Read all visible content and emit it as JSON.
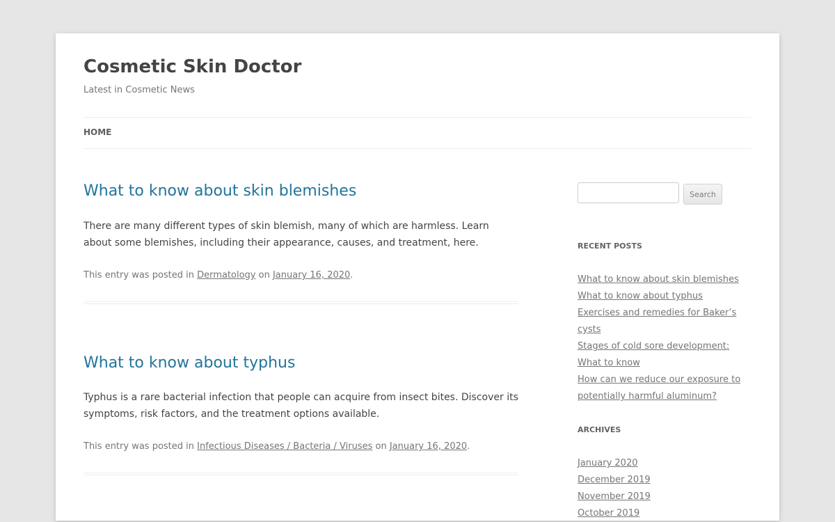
{
  "site": {
    "title": "Cosmetic Skin Doctor",
    "description": "Latest in Cosmetic News"
  },
  "nav": {
    "home": "HOME"
  },
  "posts": [
    {
      "title": "What to know about skin blemishes",
      "excerpt": "There are many different types of skin blemish, many of which are harmless. Learn about some blemishes, including their appearance, causes, and treatment, here.",
      "meta_prefix": "This entry was posted in",
      "category": "Dermatology",
      "meta_on": "on",
      "date": "January 16, 2020",
      "meta_suffix": "."
    },
    {
      "title": "What to know about typhus",
      "excerpt": "Typhus is a rare bacterial infection that people can acquire from insect bites. Discover its symp­toms, risk factors, and the treatment options available.",
      "meta_prefix": "This entry was posted in",
      "category": "Infectious Diseases / Bacteria / Viruses",
      "meta_on": "on",
      "date": "January 16, 2020",
      "meta_suffix": "."
    }
  ],
  "sidebar": {
    "search_button": "Search",
    "search_value": "",
    "recent_title": "RECENT POSTS",
    "recent_posts": [
      "What to know about skin blemishes",
      "What to know about typhus",
      "Exercises and remedies for Baker’s cysts",
      "Stages of cold sore development: What to know",
      "How can we reduce our exposure to po­tentially harmful aluminum?"
    ],
    "archives_title": "ARCHIVES",
    "archives": [
      "January 2020",
      "December 2019",
      "November 2019",
      "October 2019"
    ]
  },
  "colors": {
    "background": "#e6e6e6",
    "page": "#ffffff",
    "link_title": "#21759b",
    "text": "#444444",
    "meta": "#757575"
  }
}
